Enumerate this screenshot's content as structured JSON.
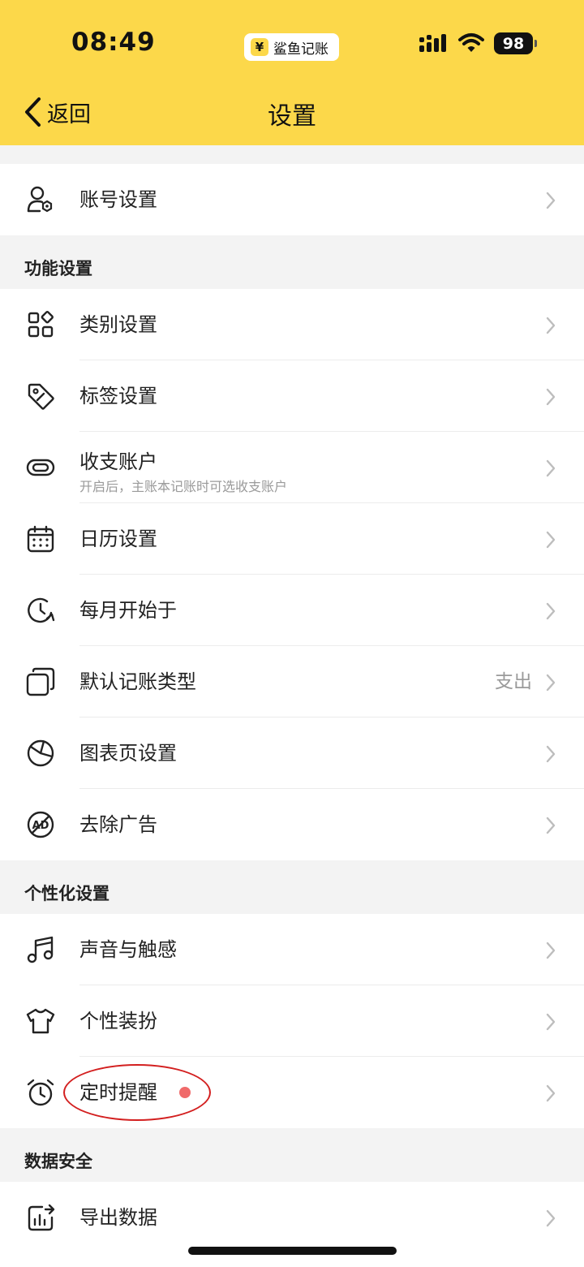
{
  "status": {
    "time": "08:49",
    "app_name": "鲨鱼记账",
    "app_symbol": "¥",
    "battery": "98"
  },
  "header": {
    "back_label": "返回",
    "title": "设置"
  },
  "account": {
    "label": "账号设置"
  },
  "sections": {
    "function": "功能设置",
    "personal": "个性化设置",
    "data": "数据安全"
  },
  "function_items": [
    {
      "label": "类别设置",
      "icon": "grid-icon"
    },
    {
      "label": "标签设置",
      "icon": "tag-icon"
    },
    {
      "label": "收支账户",
      "sub": "开启后，主账本记账时可选收支账户",
      "icon": "link-icon"
    },
    {
      "label": "日历设置",
      "icon": "calendar-icon"
    },
    {
      "label": "每月开始于",
      "icon": "clock-refresh-icon"
    },
    {
      "label": "默认记账类型",
      "value": "支出",
      "icon": "cards-icon"
    },
    {
      "label": "图表页设置",
      "icon": "pie-chart-icon"
    },
    {
      "label": "去除广告",
      "icon": "no-ad-icon"
    }
  ],
  "personal_items": [
    {
      "label": "声音与触感",
      "icon": "music-icon"
    },
    {
      "label": "个性装扮",
      "icon": "tshirt-icon"
    },
    {
      "label": "定时提醒",
      "icon": "alarm-icon",
      "badge": true
    }
  ],
  "data_items": [
    {
      "label": "导出数据",
      "icon": "export-chart-icon"
    }
  ],
  "colors": {
    "header_bg": "#fcd84a",
    "badge": "#f06a6a",
    "annotation": "#d31f1f"
  }
}
